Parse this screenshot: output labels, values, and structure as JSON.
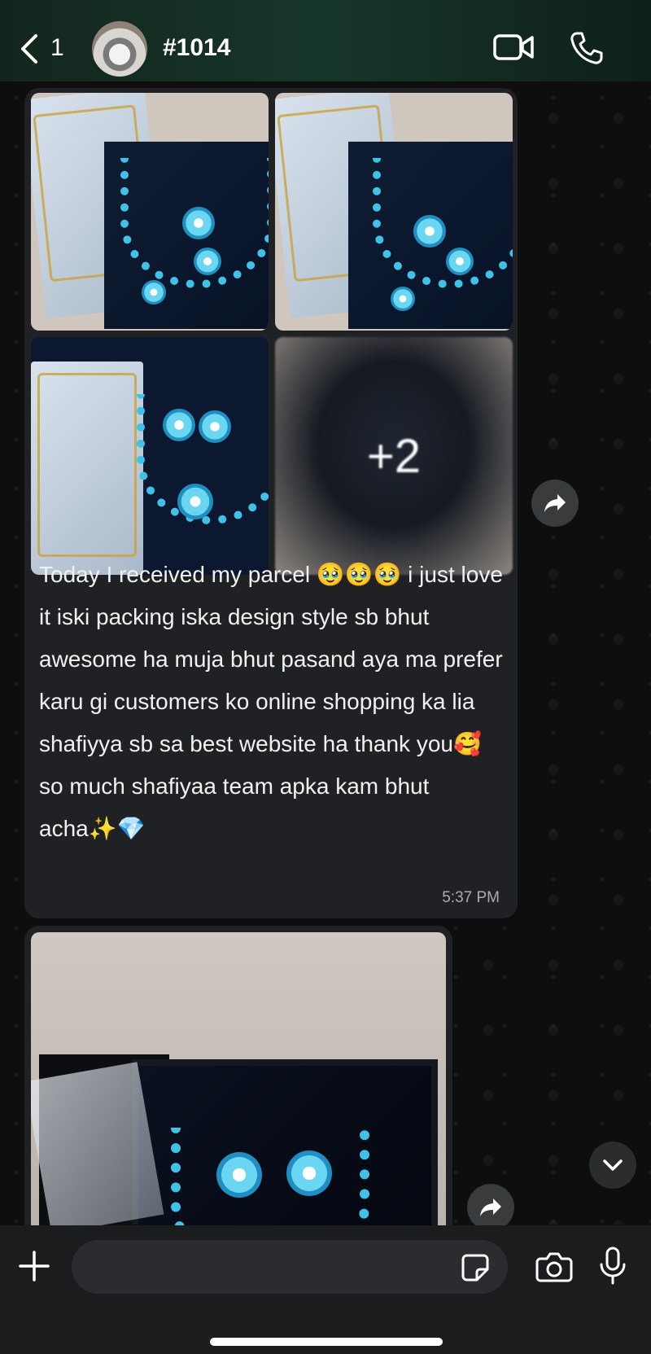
{
  "header": {
    "back_count": "1",
    "chat_title": "#1014"
  },
  "message": {
    "more_photos": "+2",
    "text": "Today I received my parcel 🥹🥹🥹 i just love it iski packing iska design style sb bhut awesome ha muja bhut pasand aya ma prefer karu gi customers ko online shopping ka lia shafiyya sb sa best website ha thank you🥰 so much shafiyaa team apka kam bhut acha✨💎",
    "time": "5:37 PM"
  },
  "input": {
    "placeholder": ""
  },
  "icons": [
    "back-chevron-icon",
    "video-call-icon",
    "phone-icon",
    "forward-icon",
    "chevron-down-icon",
    "plus-icon",
    "sticker-icon",
    "camera-icon",
    "microphone-icon"
  ]
}
